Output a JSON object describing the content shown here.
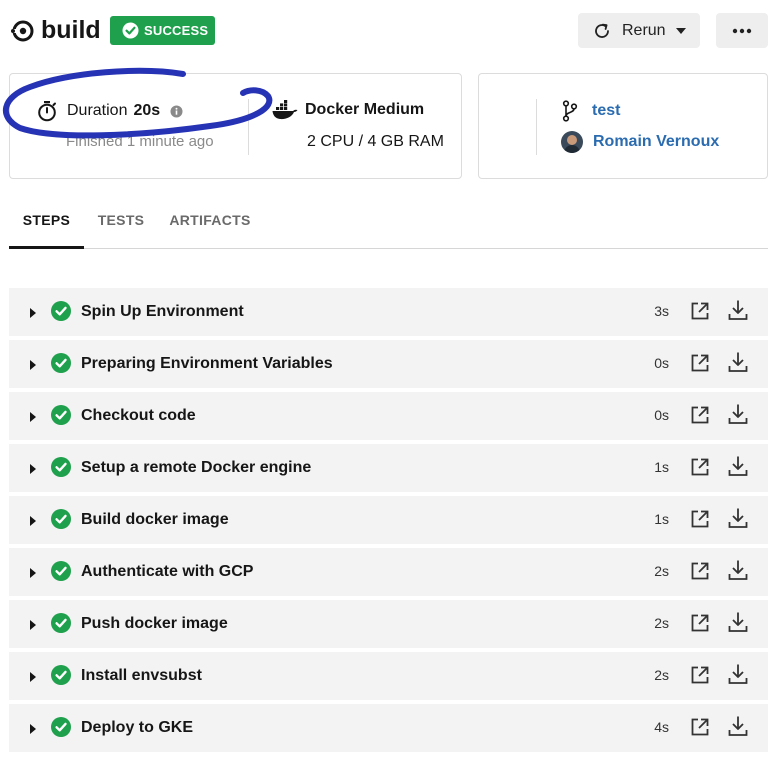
{
  "header": {
    "job_name": "build",
    "status": "SUCCESS",
    "rerun_label": "Rerun",
    "more_label": "•••",
    "status_color": "#1fa04d"
  },
  "info": {
    "duration_label": "Duration",
    "duration_value": "20s",
    "finished_text": "Finished 1 minute ago",
    "executor_name": "Docker Medium",
    "executor_spec": "2 CPU / 4 GB RAM",
    "branch": "test",
    "user": "Romain Vernoux"
  },
  "tabs": [
    {
      "label": "STEPS",
      "active": true
    },
    {
      "label": "TESTS",
      "active": false
    },
    {
      "label": "ARTIFACTS",
      "active": false
    }
  ],
  "steps": [
    {
      "name": "Spin Up Environment",
      "duration": "3s"
    },
    {
      "name": "Preparing Environment Variables",
      "duration": "0s"
    },
    {
      "name": "Checkout code",
      "duration": "0s"
    },
    {
      "name": "Setup a remote Docker engine",
      "duration": "1s"
    },
    {
      "name": "Build docker image",
      "duration": "1s"
    },
    {
      "name": "Authenticate with GCP",
      "duration": "2s"
    },
    {
      "name": "Push docker image",
      "duration": "2s"
    },
    {
      "name": "Install envsubst",
      "duration": "2s"
    },
    {
      "name": "Deploy to GKE",
      "duration": "4s"
    }
  ],
  "icons": {
    "step_status": "check-circle-icon",
    "step_expand": "expand-triangle-icon",
    "open_external": "open-external-icon",
    "download": "download-icon"
  },
  "annotation_color": "#2733b5"
}
